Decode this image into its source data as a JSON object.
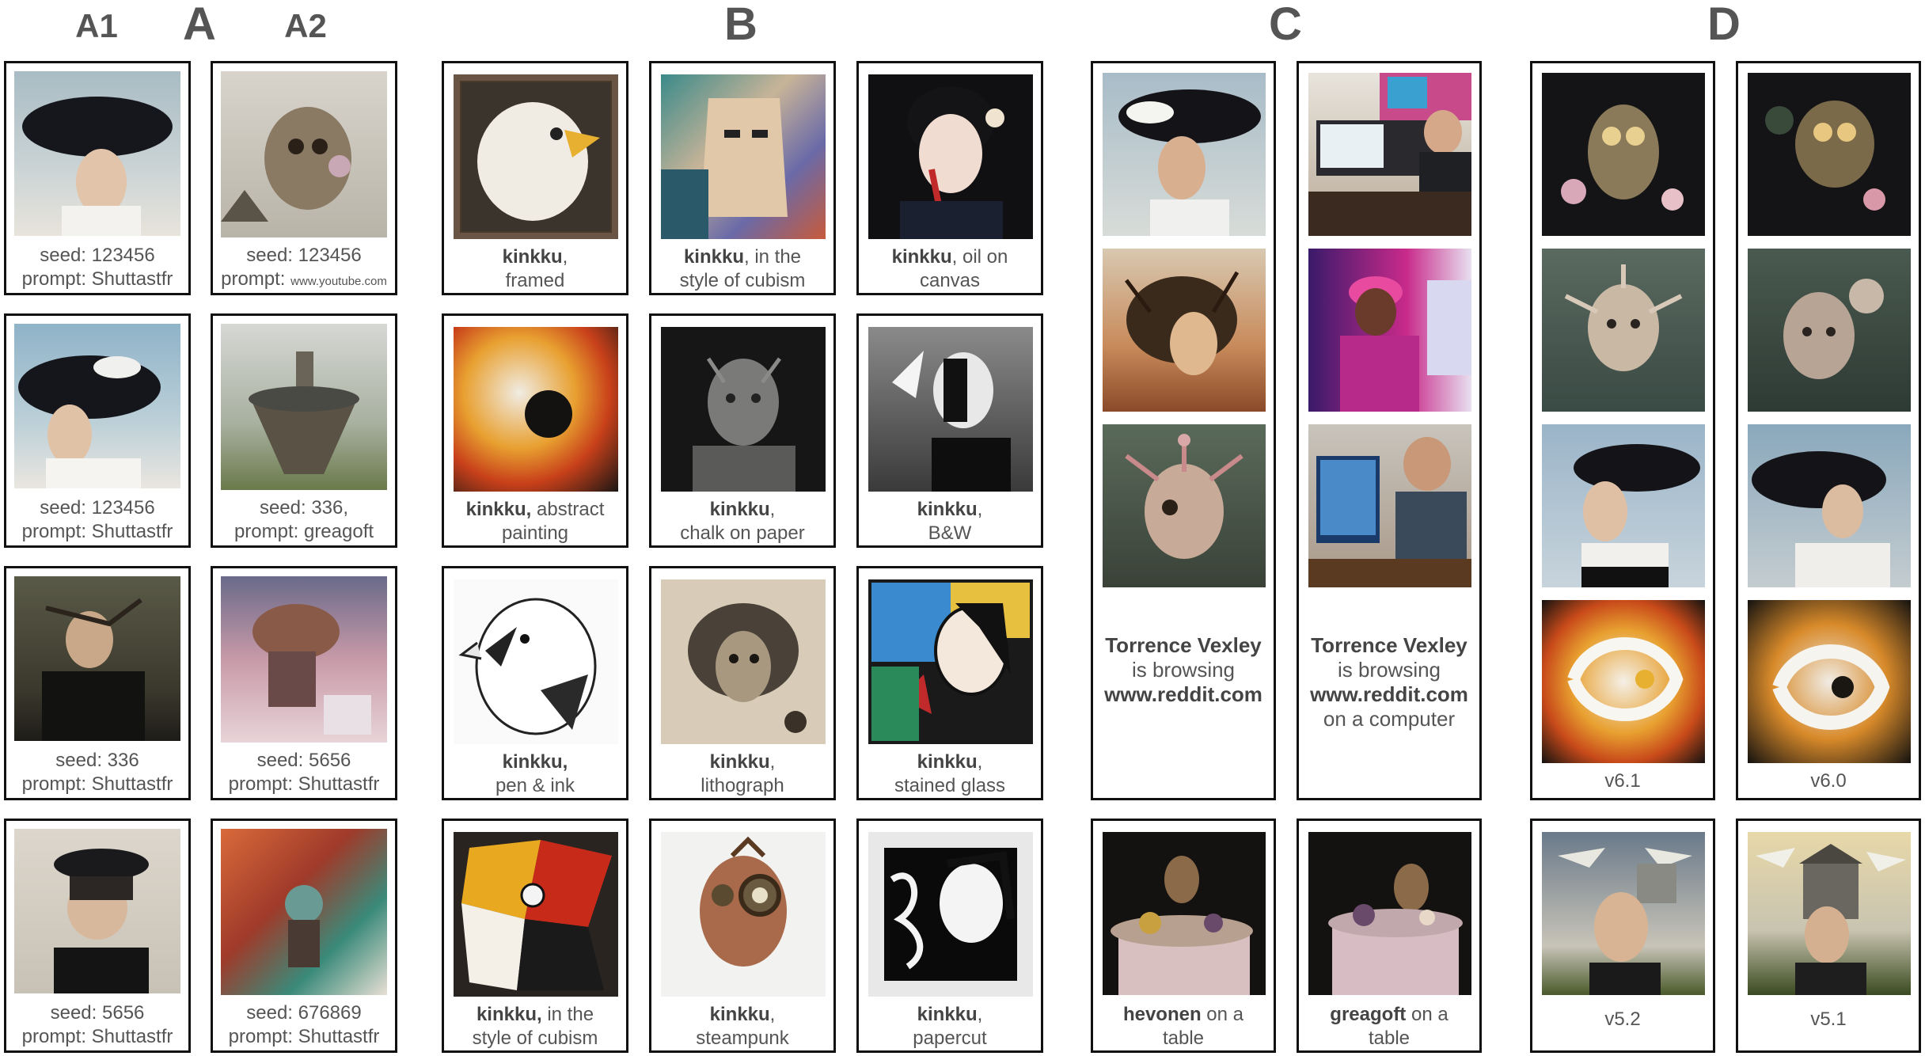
{
  "headers": {
    "a1": "A1",
    "a": "A",
    "a2": "A2",
    "b": "B",
    "c": "C",
    "d": "D"
  },
  "seed_prefix": "seed: ",
  "prompt_prefix": "prompt: ",
  "groupA1": [
    {
      "seed": "123456",
      "prompt": "Shuttastfr"
    },
    {
      "seed": "123456",
      "prompt": "Shuttastfr"
    },
    {
      "seed": "336",
      "prompt": "Shuttastfr"
    },
    {
      "seed": "5656",
      "prompt": "Shuttastfr"
    }
  ],
  "groupA2": [
    {
      "seed": "123456",
      "prompt_label": "prompt:",
      "prompt": "www.youtube.com"
    },
    {
      "seed": "336,",
      "prompt": "greagoft"
    },
    {
      "seed": "5656",
      "prompt": "Shuttastfr"
    },
    {
      "seed": "676869",
      "prompt": "Shuttastfr"
    }
  ],
  "groupB": [
    {
      "bold": "kinkku",
      "rest": ",",
      "line2": "framed"
    },
    {
      "bold": "kinkku",
      "rest": ", in the",
      "line2": "style of cubism"
    },
    {
      "bold": "kinkku",
      "rest": ", oil on",
      "line2": "canvas"
    },
    {
      "bold": "kinkku,",
      "rest": " abstract",
      "line2": "painting"
    },
    {
      "bold": "kinkku",
      "rest": ",",
      "line2": "chalk on paper"
    },
    {
      "bold": "kinkku",
      "rest": ",",
      "line2": "B&W"
    },
    {
      "bold": "kinkku,",
      "rest": "",
      "line2": "pen & ink"
    },
    {
      "bold": "kinkku",
      "rest": ",",
      "line2": "lithograph"
    },
    {
      "bold": "kinkku",
      "rest": ",",
      "line2": "stained glass"
    },
    {
      "bold": "kinkku,",
      "rest": " in the",
      "line2": "style of cubism"
    },
    {
      "bold": "kinkku",
      "rest": ",",
      "line2": "steampunk"
    },
    {
      "bold": "kinkku",
      "rest": ",",
      "line2": "papercut"
    }
  ],
  "groupC": {
    "col1": {
      "name": "Torrence Vexley",
      "line2": "is browsing",
      "site": "www.reddit.com",
      "line4": ""
    },
    "col2": {
      "name": "Torrence Vexley",
      "line2": "is browsing",
      "site": "www.reddit.com",
      "line4": "on a computer"
    },
    "bottom": [
      {
        "bold": "hevonen",
        "rest": " on a",
        "line2": "table"
      },
      {
        "bold": "greagoft",
        "rest": " on a",
        "line2": "table"
      }
    ]
  },
  "groupD": {
    "versions": [
      "v6.1",
      "v6.0",
      "v5.2",
      "v5.1"
    ]
  },
  "colors": {
    "border": "#111111",
    "text": "#555555"
  }
}
